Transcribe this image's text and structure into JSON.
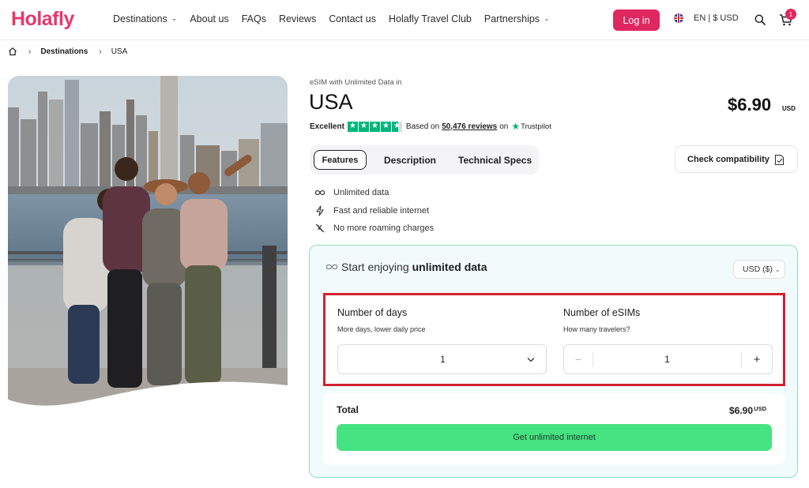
{
  "brand": {
    "logo_text": "Holafly",
    "accent": "#e0275f",
    "logo_color": "#e5386d",
    "cta_color": "#45e381",
    "highlight_border": "#d3212c"
  },
  "header": {
    "nav": [
      {
        "label": "Destinations",
        "has_dropdown": true
      },
      {
        "label": "About us",
        "has_dropdown": false
      },
      {
        "label": "FAQs",
        "has_dropdown": false
      },
      {
        "label": "Reviews",
        "has_dropdown": false
      },
      {
        "label": "Contact us",
        "has_dropdown": false
      },
      {
        "label": "Holafly Travel Club",
        "has_dropdown": false
      },
      {
        "label": "Partnerships",
        "has_dropdown": true
      }
    ],
    "login_label": "Log in",
    "locale_label": "EN | $ USD",
    "locale_flag_icon": "uk-flag-icon",
    "cart_count": "1"
  },
  "breadcrumb": {
    "items": [
      "Destinations",
      "USA"
    ]
  },
  "product": {
    "pre_title": "eSIM with Unlimited Data in",
    "title": "USA",
    "price": "$6.90",
    "price_currency": "USD",
    "rating": {
      "label": "Excellent",
      "stars": 4.5,
      "based_on_prefix": "Based on",
      "reviews_link": "50,476 reviews",
      "on_text": "on",
      "provider": "Trustpilot"
    }
  },
  "tabs": [
    {
      "label": "Features",
      "active": true
    },
    {
      "label": "Description",
      "active": false
    },
    {
      "label": "Technical Specs",
      "active": false
    }
  ],
  "check_compatibility_label": "Check compatibility",
  "features": [
    {
      "icon": "infinity-icon",
      "label": "Unlimited data"
    },
    {
      "icon": "lightning-icon",
      "label": "Fast and reliable internet"
    },
    {
      "icon": "no-roaming-icon",
      "label": "No more roaming charges"
    }
  ],
  "card": {
    "header_prefix": "Start enjoying",
    "header_bold": "unlimited data",
    "currency_select": "USD ($)",
    "days": {
      "title": "Number of days",
      "subtitle": "More days, lower daily price",
      "value": "1"
    },
    "esims": {
      "title": "Number of eSIMs",
      "subtitle": "How many travelers?",
      "value": "1",
      "minus": "−",
      "plus": "+"
    },
    "total_label": "Total",
    "total_price": "$6.90",
    "total_currency": "USD",
    "cta_label": "Get unlimited internet"
  }
}
